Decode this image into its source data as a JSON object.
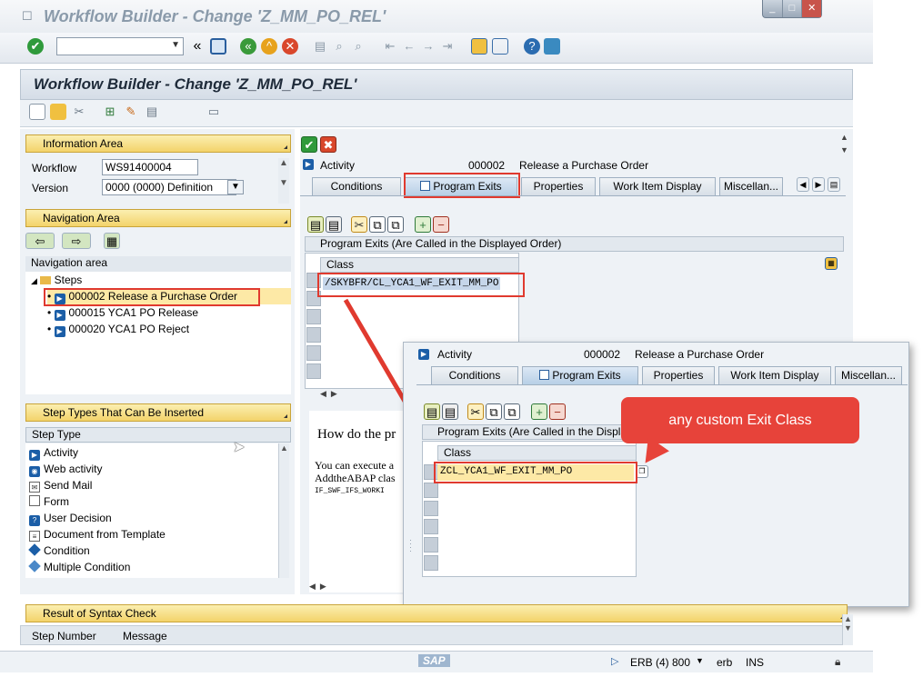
{
  "window": {
    "title": "Workflow Builder - Change 'Z_MM_PO_REL'",
    "controls": [
      "_",
      "□",
      "✕"
    ]
  },
  "toolbar": {
    "back": "«"
  },
  "header": {
    "title": "Workflow Builder - Change 'Z_MM_PO_REL'"
  },
  "info_area": {
    "title": "Information Area",
    "workflow_label": "Workflow",
    "workflow_value": "WS91400004",
    "version_label": "Version",
    "version_value": "0000 (0000) Definition"
  },
  "nav_area": {
    "title": "Navigation Area",
    "subheader": "Navigation area",
    "root": "Steps",
    "items": [
      "000002 Release a Purchase Order",
      "000015 YCA1 PO Release",
      "000020 YCA1 PO Reject"
    ]
  },
  "step_types": {
    "title": "Step Types That Can Be Inserted",
    "column": "Step Type",
    "items": [
      "Activity",
      "Web activity",
      "Send Mail",
      "Form",
      "User Decision",
      "Document from Template",
      "Condition",
      "Multiple Condition"
    ]
  },
  "activity": {
    "label": "Activity",
    "number": "000002",
    "name": "Release a Purchase Order"
  },
  "tabs": [
    "Conditions",
    "Program Exits",
    "Properties",
    "Work Item Display",
    "Miscellan..."
  ],
  "program_exits": {
    "title": "Program Exits (Are Called in the Displayed Order)",
    "column": "Class",
    "value": "/SKYBFR/CL_YCA1_WF_EXIT_MM_PO"
  },
  "help": {
    "heading": "How do the pr",
    "line1": "You can execute a",
    "line2": "AddtheABAP clas",
    "line3": "IF_SWF_IFS_WORKI"
  },
  "zoom": {
    "title_truncated": "Program Exits (Are Called in the Displa",
    "value": "ZCL_YCA1_WF_EXIT_MM_PO"
  },
  "callout": {
    "text": "any custom Exit Class"
  },
  "result": {
    "title": "Result of Syntax Check",
    "col_step": "Step Number",
    "col_msg": "Message"
  },
  "status": {
    "system": "ERB (4) 800",
    "server": "erb",
    "mode": "INS",
    "logo": "SAP"
  },
  "colors": {
    "red": "#e03a2f",
    "gold": "#f3d36a",
    "sapblue": "#1b5ea7"
  }
}
